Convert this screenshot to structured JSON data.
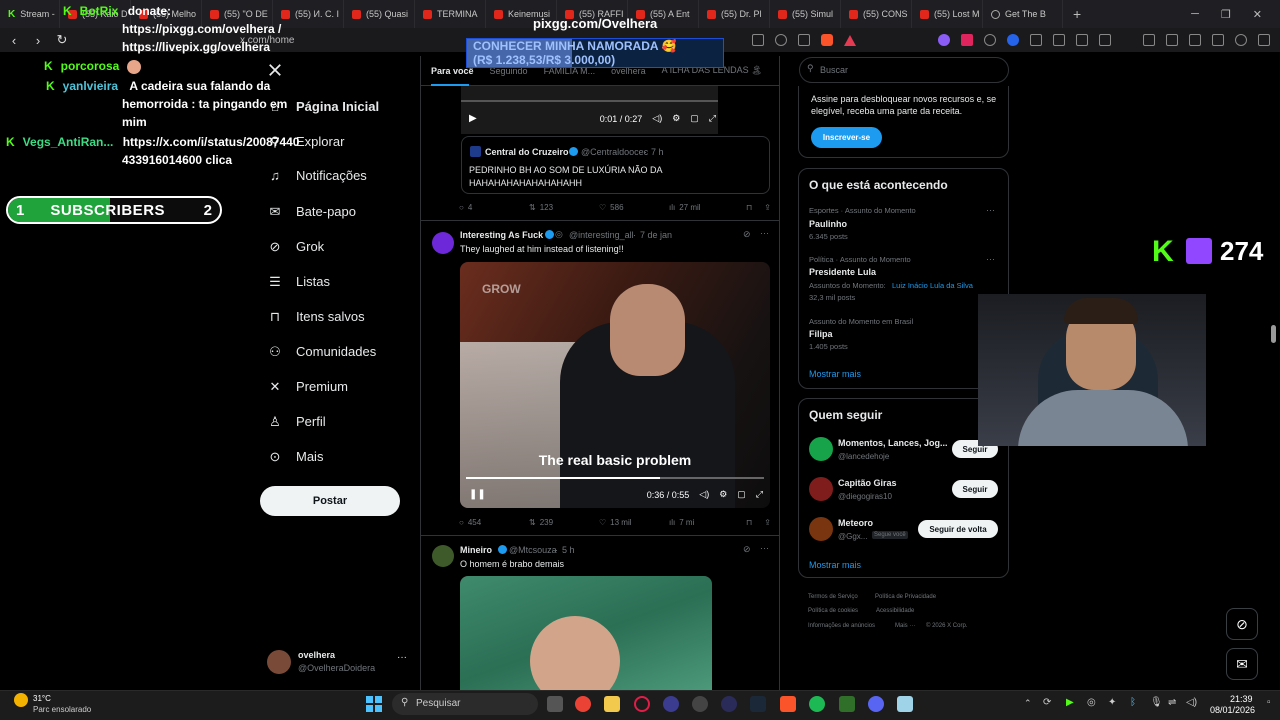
{
  "browser": {
    "tabs": [
      {
        "label": "Stream -",
        "icon": "kick"
      },
      {
        "label": "(55) Kaio D",
        "icon": "youtube"
      },
      {
        "label": "(55) Melho",
        "icon": "youtube"
      },
      {
        "label": "(55) \"O DE",
        "icon": "youtube"
      },
      {
        "label": "(55) И. С. I",
        "icon": "youtube"
      },
      {
        "label": "(55) Quasi",
        "icon": "youtube"
      },
      {
        "label": "TERMINA",
        "icon": "youtube"
      },
      {
        "label": "Keinemusi",
        "icon": "youtube"
      },
      {
        "label": "(55) RAFFI",
        "icon": "youtube"
      },
      {
        "label": "(55) A Ent",
        "icon": "youtube"
      },
      {
        "label": "(55) Dr. Pl",
        "icon": "youtube"
      },
      {
        "label": "(55) Simul",
        "icon": "youtube"
      },
      {
        "label": "(55) CONS",
        "icon": "youtube"
      },
      {
        "label": "(55) Lost M",
        "icon": "youtube"
      },
      {
        "label": "Get The B",
        "icon": "globe"
      }
    ],
    "url": "x.com/home"
  },
  "stream_overlay": {
    "chat": [
      {
        "user": "BotRix",
        "message": "donate:"
      },
      {
        "user": "",
        "message": "https://pixgg.com/ovelhera /"
      },
      {
        "user": "",
        "message": "https://livepix.gg/ovelhera"
      },
      {
        "user": "porcorosa",
        "message": ""
      },
      {
        "user": "yanlvieira",
        "message": "A cadeira sua falando da"
      },
      {
        "user": "",
        "message": "hemorroida : ta pingando em"
      },
      {
        "user": "",
        "message": "mim"
      },
      {
        "user": "Vegs_AntiRan...",
        "message": "https://x.com/i/status/20087440"
      },
      {
        "user": "",
        "message": "433916014600 clica"
      }
    ],
    "subscribers": {
      "current": "1",
      "label": "SUBSCRIBERS",
      "goal": "2",
      "progress": 0.48
    },
    "donation_goal": {
      "line1": "CONHECER MINHA NAMORADA 🥰",
      "line2": "(R$ 1.238,53/R$ 3.000,00)",
      "progress": 0.41
    },
    "pix_title": "pixgg.com/Ovelhera",
    "viewer_count": "274"
  },
  "x_nav": {
    "items": [
      {
        "label": "Página Inicial",
        "icon": "home-icon"
      },
      {
        "label": "Explorar",
        "icon": "search-icon"
      },
      {
        "label": "Notificações",
        "icon": "bell-icon"
      },
      {
        "label": "Bate-papo",
        "icon": "mail-icon"
      },
      {
        "label": "Grok",
        "icon": "grok-icon"
      },
      {
        "label": "Listas",
        "icon": "list-icon"
      },
      {
        "label": "Itens salvos",
        "icon": "bookmark-icon"
      },
      {
        "label": "Comunidades",
        "icon": "people-icon"
      },
      {
        "label": "Premium",
        "icon": "x-icon"
      },
      {
        "label": "Perfil",
        "icon": "person-icon"
      },
      {
        "label": "Mais",
        "icon": "more-icon"
      }
    ],
    "post_button": "Postar",
    "account": {
      "name": "ovelhera",
      "handle": "@OvelheraDoidera"
    }
  },
  "feed": {
    "tabs": [
      "Para você",
      "Seguindo",
      "FAMÍLIA M...",
      "ovelhera",
      "A ILHA DAS LENDAS 🏝"
    ],
    "tweets": [
      {
        "video_time": "0:01 / 0:27",
        "quote": {
          "name": "Central do Cruzeiro",
          "handle": "@Centraldoocec",
          "time": "7 h",
          "text1": "PEDRINHO BH AO SOM DE LUXÚRIA NÃO DA",
          "text2": "HAHAHAHAHAHAHAHAHH"
        },
        "stats": {
          "replies": "4",
          "retweets": "123",
          "likes": "586",
          "views": "27 mil"
        }
      },
      {
        "name": "Interesting As Fuck",
        "handle": "@interesting_all",
        "time": "7 de jan",
        "text": "They laughed at him instead of listening!!",
        "video_watermark": "GROW",
        "caption": "The real basic problem",
        "video_time": "0:36 / 0:55",
        "stats": {
          "replies": "454",
          "retweets": "239",
          "likes": "13 mil",
          "views": "7 mi"
        }
      },
      {
        "name": "Mineiro",
        "handle": "@Mtcsouza",
        "time": "5 h",
        "text": "O homem é brabo demais"
      }
    ]
  },
  "right": {
    "search_placeholder": "Buscar",
    "premium": {
      "text1": "Assine para desbloquear novos recursos e, se",
      "text2": "elegível, receba uma parte da receita.",
      "button": "Inscrever-se"
    },
    "trends": {
      "title": "O que está acontecendo",
      "items": [
        {
          "category": "Esportes · Assunto do Momento",
          "name": "Paulinho",
          "count": "6.345 posts"
        },
        {
          "category": "Política · Assunto do Momento",
          "name": "Presidente Lula",
          "extra_label": "Assuntos do Momento:",
          "extra_link": "Luiz Inácio Lula da Silva",
          "count": "32,3 mil posts"
        },
        {
          "category": "Assunto do Momento em Brasil",
          "name": "Filipa",
          "count": "1.405 posts"
        }
      ],
      "more": "Mostrar mais"
    },
    "who_to_follow": {
      "title": "Quem seguir",
      "items": [
        {
          "name": "Momentos, Lances, Jog...",
          "handle": "@lancedehoje",
          "button": "Seguir"
        },
        {
          "name": "Capitão Giras",
          "handle": "@diegogiras10",
          "button": "Seguir"
        },
        {
          "name": "Meteoro",
          "handle": "@Ggx...",
          "badge": "Segue você",
          "button": "Seguir de volta"
        }
      ],
      "more": "Mostrar mais"
    },
    "footer": [
      "Termos de Serviço",
      "Política de Privacidade",
      "Política de cookies",
      "Acessibilidade",
      "Informações de anúncios",
      "Mais ···",
      "© 2026 X Corp."
    ]
  },
  "taskbar": {
    "weather_temp": "31°C",
    "weather_desc": "Parc ensolarado",
    "search": "Pesquisar",
    "time": "21:39",
    "date": "08/01/2026"
  },
  "colors": {
    "kick_green": "#53fc18",
    "x_blue": "#1d9bf0",
    "twitch_purple": "#9146ff"
  }
}
